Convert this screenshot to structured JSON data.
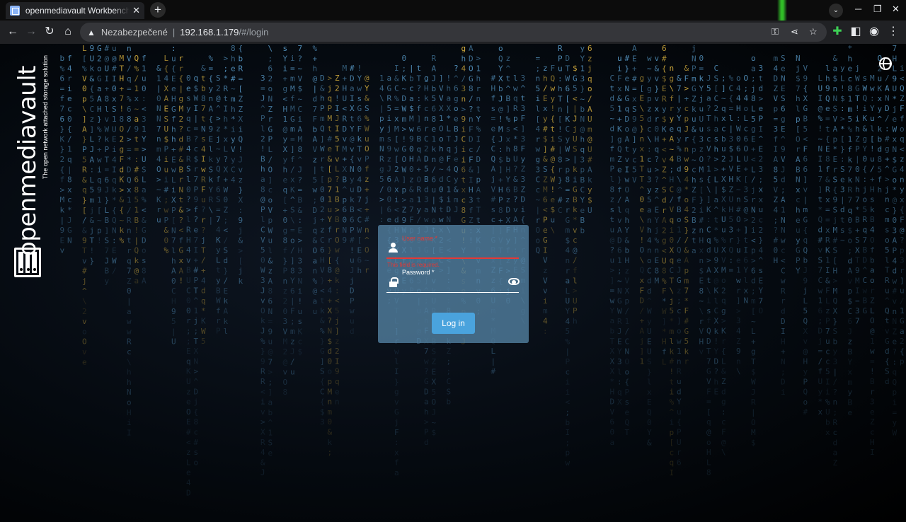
{
  "browser": {
    "tab_title": "openmediavault Workbench",
    "tab_close": "✕",
    "new_tab": "+",
    "security_label": "Nezabezpečené",
    "separator": "|",
    "url_host": "192.168.1.179",
    "url_path": "/#/login"
  },
  "branding": {
    "name": "openmediavault",
    "tagline": "The open network attached storage solution"
  },
  "login": {
    "username_label": "User name *",
    "username_value": "",
    "username_error": "This field is required.",
    "password_label": "Password *",
    "password_value": "",
    "submit_label": "Log in"
  },
  "colors": {
    "error": "#e53935",
    "button": "#4aa3dd",
    "rain_blue": "#5fa6d8",
    "rain_yellow": "#f3c644"
  },
  "icons": [
    "back-icon",
    "forward-icon",
    "reload-icon",
    "home-icon",
    "warning-icon",
    "key-icon",
    "share-icon",
    "star-icon",
    "extensions-icon",
    "sidepanel-icon",
    "profile-icon",
    "menu-icon",
    "globe-icon",
    "person-icon",
    "lock-icon",
    "eye-icon"
  ]
}
